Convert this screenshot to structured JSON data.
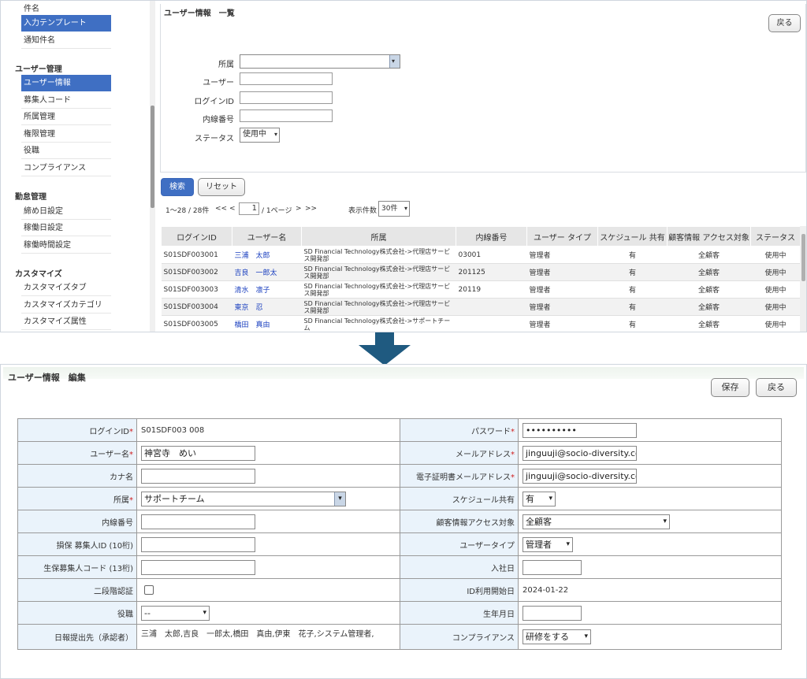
{
  "sidebar": {
    "items_top": [
      "件名",
      "入力テンプレート",
      "通知件名"
    ],
    "sections": [
      {
        "title": "ユーザー管理",
        "items": [
          "ユーザー情報",
          "募集人コード",
          "所属管理",
          "権限管理",
          "役職",
          "コンプライアンス"
        ]
      },
      {
        "title": "勤怠管理",
        "items": [
          "締め日設定",
          "稼働日設定",
          "稼働時間設定"
        ]
      },
      {
        "title": "カスタマイズ",
        "items": [
          "カスタマイズタブ",
          "カスタマイズカテゴリ",
          "カスタマイズ属性"
        ]
      }
    ]
  },
  "list_page": {
    "title": "ユーザー情報　一覧",
    "back_button": "戻る",
    "filters": {
      "affiliation_label": "所属",
      "user_label": "ユーザー",
      "login_id_label": "ログインID",
      "extension_label": "内線番号",
      "status_label": "ステータス",
      "status_value": "使用中"
    },
    "search_button": "検索",
    "reset_button": "リセット",
    "pagination": {
      "range": "1～28 / 28件",
      "first": "<<",
      "prev": "<",
      "page": "1",
      "total": "/ 1ページ",
      "next": ">",
      "last": ">>"
    },
    "per_page_label": "表示件数",
    "per_page_value": "30件",
    "columns": [
      "ログインID",
      "ユーザー名",
      "所属",
      "内線番号",
      "ユーザー タイプ",
      "スケジュール 共有",
      "顧客情報 アクセス対象",
      "ステータス"
    ],
    "rows": [
      {
        "login_id": "S01SDF003001",
        "name": "三浦　太郎",
        "affiliation": "SD Financial Technology株式会社->代理店サービス開発部",
        "ext": "03001",
        "type": "管理者",
        "schedule": "有",
        "access": "全顧客",
        "status": "使用中"
      },
      {
        "login_id": "S01SDF003002",
        "name": "吉良　一郎太",
        "affiliation": "SD Financial Technology株式会社->代理店サービス開発部",
        "ext": "201125",
        "type": "管理者",
        "schedule": "有",
        "access": "全顧客",
        "status": "使用中"
      },
      {
        "login_id": "S01SDF003003",
        "name": "清水　凛子",
        "affiliation": "SD Financial Technology株式会社->代理店サービス開発部",
        "ext": "20119",
        "type": "管理者",
        "schedule": "有",
        "access": "全顧客",
        "status": "使用中"
      },
      {
        "login_id": "S01SDF003004",
        "name": "東京　忍",
        "affiliation": "SD Financial Technology株式会社->代理店サービス開発部",
        "ext": "",
        "type": "管理者",
        "schedule": "有",
        "access": "全顧客",
        "status": "使用中"
      },
      {
        "login_id": "S01SDF003005",
        "name": "橋田　真由",
        "affiliation": "SD Financial Technology株式会社->サポートチーム",
        "ext": "",
        "type": "管理者",
        "schedule": "有",
        "access": "全顧客",
        "status": "使用中"
      }
    ]
  },
  "arrow_color": "#1f5a80",
  "edit_page": {
    "title": "ユーザー情報　編集",
    "save_button": "保存",
    "back_button": "戻る",
    "required_mark": "*",
    "labels": {
      "login_id": "ログインID",
      "user_name": "ユーザー名",
      "kana": "カナ名",
      "affiliation": "所属",
      "extension": "内線番号",
      "nonlife_id": "損保 募集人ID (10桁)",
      "life_code": "生保募集人コード (13桁)",
      "two_factor": "二段階認証",
      "position": "役職",
      "report_to": "日報提出先（承認者）",
      "password": "パスワード",
      "email": "メールアドレス",
      "cert_email": "電子証明書メールアドレス",
      "schedule": "スケジュール共有",
      "access": "顧客情報アクセス対象",
      "user_type": "ユーザータイプ",
      "join_date": "入社日",
      "id_start": "ID利用開始日",
      "birthday": "生年月日",
      "compliance": "コンプライアンス"
    },
    "values": {
      "login_id": "S01SDF003 008",
      "user_name": "神宮寺　めい",
      "kana": "",
      "affiliation": "サポートチーム",
      "extension": "",
      "nonlife_id": "",
      "life_code": "",
      "position": "--",
      "report_to": "三浦　太郎,吉良　一郎太,橋田　真由,伊東　花子,システム管理者,",
      "password": "••••••••••",
      "email": "jinguuji@socio-diversity.co.j",
      "cert_email": "jinguuji@socio-diversity.co.j",
      "schedule": "有",
      "access": "全顧客",
      "user_type": "管理者",
      "join_date": "",
      "id_start": "2024-01-22",
      "birthday": "",
      "compliance": "研修をする"
    }
  }
}
